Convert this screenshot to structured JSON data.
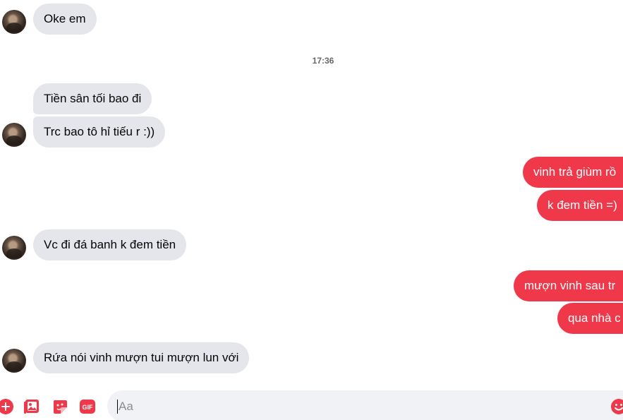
{
  "timestamp": "17:36",
  "messages": {
    "m1": "Oke em",
    "m2": "Tiền sân tối bao đi",
    "m3": "Trc bao tô hỉ tiếu r :))",
    "m4": "vinh trả giùm rồ",
    "m5": "k đem tiền =)",
    "m6": "Vc đi đá banh k đem tiền",
    "m7": "mượn vinh sau tr",
    "m8": "qua nhà c",
    "m9": "Rứa nói vinh mượn tui mượn lun với"
  },
  "composer": {
    "placeholder": "Aa",
    "icons": [
      "plus-icon",
      "photo-icon",
      "sticker-icon",
      "gif-icon",
      "emoji-icon"
    ],
    "gif_label": "GIF"
  },
  "colors": {
    "outgoing": "#f0384b",
    "incoming": "#e4e6eb",
    "accent": "#f0384b"
  }
}
